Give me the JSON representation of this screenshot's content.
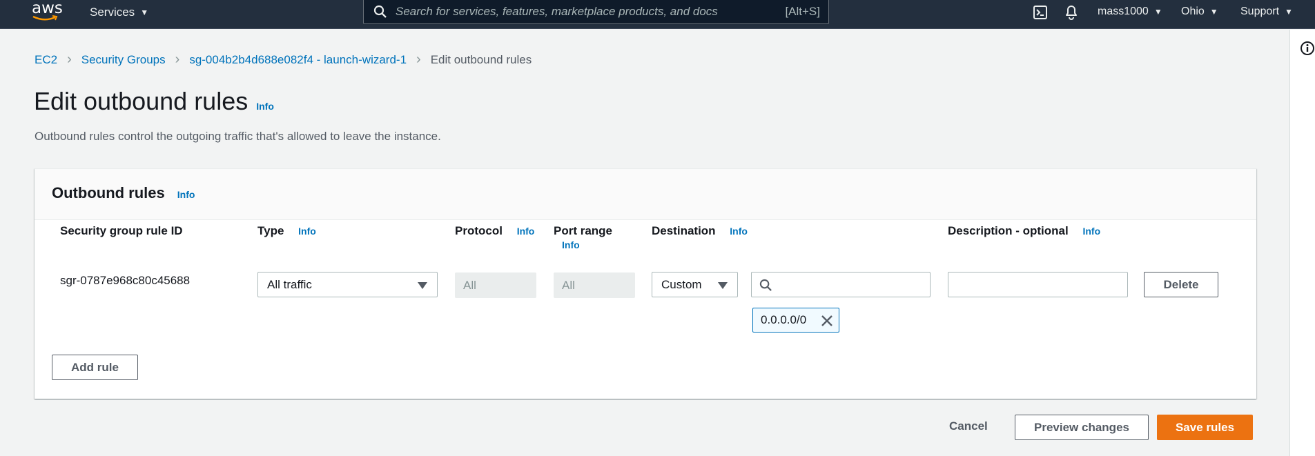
{
  "topnav": {
    "logo": "aws",
    "services_label": "Services",
    "search_placeholder": "Search for services, features, marketplace products, and docs",
    "search_shortcut": "[Alt+S]",
    "icons": [
      "cloudshell-icon",
      "bell-icon"
    ],
    "account": "mass1000",
    "region": "Ohio",
    "support": "Support"
  },
  "breadcrumb": [
    {
      "label": "EC2",
      "link": true
    },
    {
      "label": "Security Groups",
      "link": true
    },
    {
      "label": "sg-004b2b4d688e082f4 - launch-wizard-1",
      "link": true
    },
    {
      "label": "Edit outbound rules",
      "link": false
    }
  ],
  "page": {
    "title": "Edit outbound rules",
    "info": "Info",
    "description": "Outbound rules control the outgoing traffic that's allowed to leave the instance."
  },
  "card": {
    "title": "Outbound rules",
    "info": "Info",
    "columns": [
      {
        "label": "Security group rule ID",
        "info": null
      },
      {
        "label": "Type",
        "info": "Info"
      },
      {
        "label": "Protocol",
        "info": "Info"
      },
      {
        "label": "Port range",
        "info": "Info"
      },
      {
        "label": "Destination",
        "info": "Info"
      },
      {
        "label": "Description - optional",
        "info": "Info"
      }
    ],
    "rules": [
      {
        "rule_id": "sgr-0787e968c80c45688",
        "type": "All traffic",
        "protocol": "All",
        "port_range": "All",
        "destination_type": "Custom",
        "destination_search": "",
        "destination_tokens": [
          "0.0.0.0/0"
        ],
        "description": "",
        "delete_label": "Delete"
      }
    ],
    "add_rule_label": "Add rule"
  },
  "footer": {
    "cancel": "Cancel",
    "preview": "Preview changes",
    "save": "Save rules"
  },
  "colors": {
    "nav_bg": "#232f3e",
    "link": "#0073bb",
    "primary": "#ec7211",
    "page_bg": "#f2f3f3"
  }
}
